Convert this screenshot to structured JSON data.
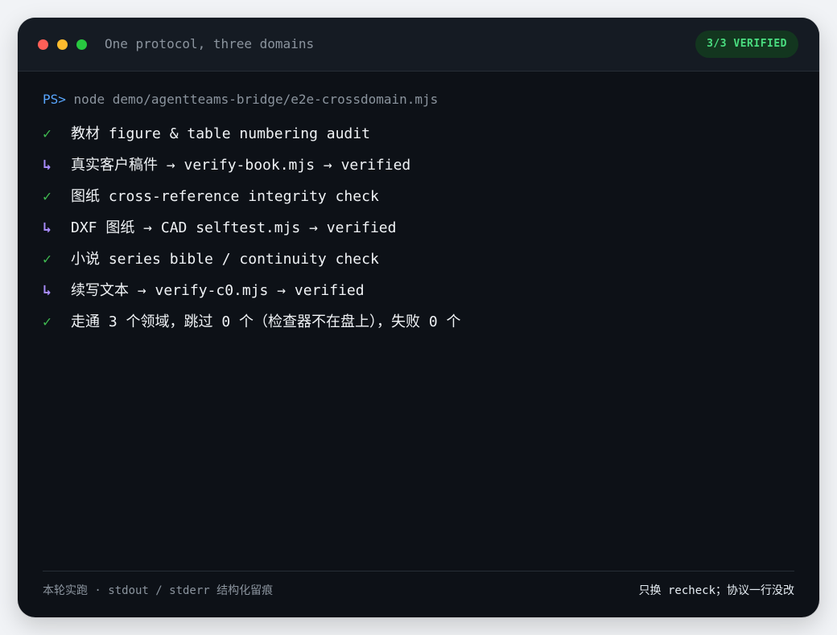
{
  "window": {
    "title": "One protocol, three domains",
    "badge": "3/3 VERIFIED"
  },
  "terminal": {
    "prompt": "PS>",
    "command": "node demo/agentteams-bridge/e2e-crossdomain.mjs",
    "lines": [
      {
        "mark": "✓",
        "kind": "check",
        "text": "教材  figure & table numbering audit"
      },
      {
        "mark": "↳",
        "kind": "branch",
        "text": "真实客户稿件 → verify-book.mjs → verified"
      },
      {
        "mark": "✓",
        "kind": "check",
        "text": "图纸  cross-reference integrity check"
      },
      {
        "mark": "↳",
        "kind": "branch",
        "text": "DXF 图纸 → CAD selftest.mjs → verified"
      },
      {
        "mark": "✓",
        "kind": "check",
        "text": "小说  series bible / continuity check"
      },
      {
        "mark": "↳",
        "kind": "branch",
        "text": "续写文本 → verify-c0.mjs → verified"
      },
      {
        "mark": "✓",
        "kind": "check",
        "text": "走通 3 个领域，跳过 0 个（检查器不在盘上），失败 0 个"
      }
    ]
  },
  "footer": {
    "left": "本轮实跑 · stdout / stderr 结构化留痕",
    "right": "只换 recheck；协议一行没改"
  },
  "colors": {
    "window_bg": "#0d1117",
    "titlebar_bg": "#151b23",
    "accent_green": "#3fb950",
    "branch_purple": "#a78bfa",
    "prompt_blue": "#58a6ff",
    "badge_bg": "#13361f",
    "badge_text": "#4ade80"
  }
}
